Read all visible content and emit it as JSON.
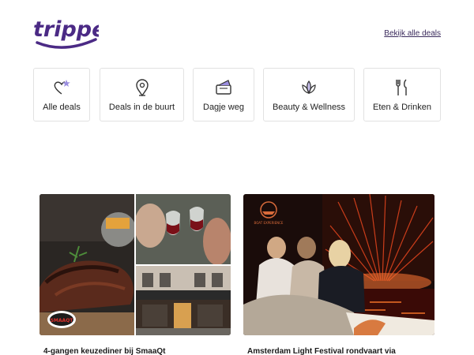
{
  "header": {
    "logo_text": "tripper",
    "view_all_label": "Bekijk alle deals"
  },
  "categories": [
    {
      "label": "Alle deals",
      "icon": "heart-star-icon"
    },
    {
      "label": "Deals in de buurt",
      "icon": "location-pin-icon"
    },
    {
      "label": "Dagje weg",
      "icon": "ticket-icon"
    },
    {
      "label": "Beauty & Wellness",
      "icon": "lotus-icon"
    },
    {
      "label": "Eten & Drinken",
      "icon": "fork-knife-icon"
    }
  ],
  "deals": [
    {
      "title": "4-gangen keuzediner bij SmaaQt",
      "badge": "SMAAQT"
    },
    {
      "title": "Amsterdam Light Festival rondvaart via",
      "badge": "BOAT EXPERIENCE"
    }
  ],
  "colors": {
    "brand": "#4b2a85",
    "accent": "#9b8ee0"
  }
}
